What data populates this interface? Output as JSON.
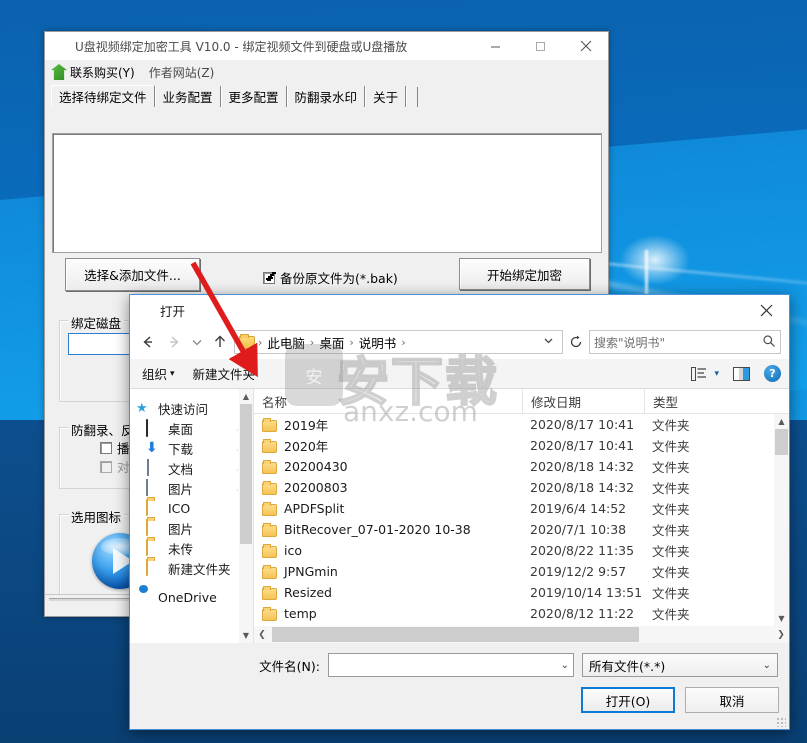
{
  "desktop": {
    "wallpaper_name": "windows-10-hero-blue"
  },
  "app_window": {
    "icon": "app-key-icon",
    "title": "U盘视频绑定加密工具 V10.0 - 绑定视频文件到硬盘或U盘播放",
    "window_controls": {
      "minimize": "minimize-icon",
      "maximize": "maximize-icon",
      "close": "close-icon"
    },
    "menubar": [
      {
        "icon": "home-green-icon",
        "label": "联系购买(Y)"
      },
      {
        "icon": "",
        "label": "作者网站(Z)"
      }
    ],
    "tabs": [
      {
        "label": "选择待绑定文件",
        "active": true
      },
      {
        "label": "业务配置",
        "active": false
      },
      {
        "label": "更多配置",
        "active": false
      },
      {
        "label": "防翻录水印",
        "active": false
      },
      {
        "label": "关于",
        "active": false
      }
    ],
    "file_list_value": "",
    "choose_add_button": "选择&添加文件...",
    "backup_checkbox": {
      "label": "备份原文件为(*.bak)",
      "checked": true
    },
    "start_button": "开始绑定加密",
    "group_disk": {
      "title": "绑定磁盘",
      "input_value": ""
    },
    "group_anti": {
      "title": "防翻录、反",
      "rows": [
        {
          "label": "播放",
          "checked": false,
          "disabled": false
        },
        {
          "label": "对应",
          "checked": false,
          "disabled": true
        }
      ]
    },
    "group_icon": {
      "title": "选用图标",
      "icon": "play-button-icon"
    }
  },
  "open_dialog": {
    "icon": "app-key-icon",
    "title": "打开",
    "close_icon": "close-icon",
    "nav": {
      "back_icon": "arrow-left-icon",
      "forward_icon": "arrow-right-icon",
      "recent_icon": "chevron-down-icon",
      "up_icon": "arrow-up-icon"
    },
    "breadcrumb": {
      "folder_icon": "folder-icon",
      "items": [
        "此电脑",
        "桌面",
        "说明书"
      ],
      "separator": "›",
      "dropdown_icon": "chevron-down-icon",
      "refresh_icon": "refresh-icon"
    },
    "search": {
      "placeholder": "搜索\"说明书\"",
      "value": "",
      "icon": "search-icon"
    },
    "toolbar": {
      "organize": "组织",
      "organize_caret": "▾",
      "new_folder": "新建文件夹",
      "view_list_icon": "view-details-icon",
      "view_caret": "▾",
      "preview_pane_icon": "preview-pane-icon",
      "help_icon": "help-icon",
      "help_label": "?"
    },
    "navpane": [
      {
        "label": "快速访问",
        "icon": "star-icon",
        "root": true,
        "pinned": false
      },
      {
        "label": "桌面",
        "icon": "desktop-icon",
        "root": false,
        "pinned": true
      },
      {
        "label": "下载",
        "icon": "download-icon",
        "root": false,
        "pinned": true
      },
      {
        "label": "文档",
        "icon": "documents-icon",
        "root": false,
        "pinned": true
      },
      {
        "label": "图片",
        "icon": "pictures-icon",
        "root": false,
        "pinned": true
      },
      {
        "label": "ICO",
        "icon": "folder-icon",
        "root": false,
        "pinned": false
      },
      {
        "label": "图片",
        "icon": "folder-icon",
        "root": false,
        "pinned": false
      },
      {
        "label": "未传",
        "icon": "folder-icon",
        "root": false,
        "pinned": false
      },
      {
        "label": "新建文件夹",
        "icon": "folder-icon",
        "root": false,
        "pinned": false
      },
      {
        "label": "OneDrive",
        "icon": "cloud-icon",
        "root": true,
        "pinned": false
      }
    ],
    "columns": [
      "名称",
      "修改日期",
      "类型"
    ],
    "files": [
      {
        "name": "2019年",
        "modified": "2020/8/17 10:41",
        "type": "文件夹"
      },
      {
        "name": "2020年",
        "modified": "2020/8/17 10:41",
        "type": "文件夹"
      },
      {
        "name": "20200430",
        "modified": "2020/8/18 14:32",
        "type": "文件夹"
      },
      {
        "name": "20200803",
        "modified": "2020/8/18 14:32",
        "type": "文件夹"
      },
      {
        "name": "APDFSplit",
        "modified": "2019/6/4 14:52",
        "type": "文件夹"
      },
      {
        "name": "BitRecover_07-01-2020 10-38",
        "modified": "2020/7/1 10:38",
        "type": "文件夹"
      },
      {
        "name": "ico",
        "modified": "2020/8/22 11:35",
        "type": "文件夹"
      },
      {
        "name": "JPNGmin",
        "modified": "2019/12/2 9:57",
        "type": "文件夹"
      },
      {
        "name": "Resized",
        "modified": "2019/10/14 13:51",
        "type": "文件夹"
      },
      {
        "name": "temp",
        "modified": "2020/8/12 11:22",
        "type": "文件夹"
      }
    ],
    "footer": {
      "filename_label": "文件名(N):",
      "filename_value": "",
      "filename_caret": "⌄",
      "filter_value": "所有文件(*.*)",
      "filter_caret": "⌄",
      "open_button": "打开(O)",
      "cancel_button": "取消"
    }
  },
  "watermark": {
    "shield_char": "安",
    "big_text": "安下载",
    "sub_text": "anxz.com"
  },
  "annotation": {
    "type": "red-arrow",
    "color": "#e01b1b",
    "points": "193,263 → 251,363",
    "target": "新建文件夹"
  }
}
